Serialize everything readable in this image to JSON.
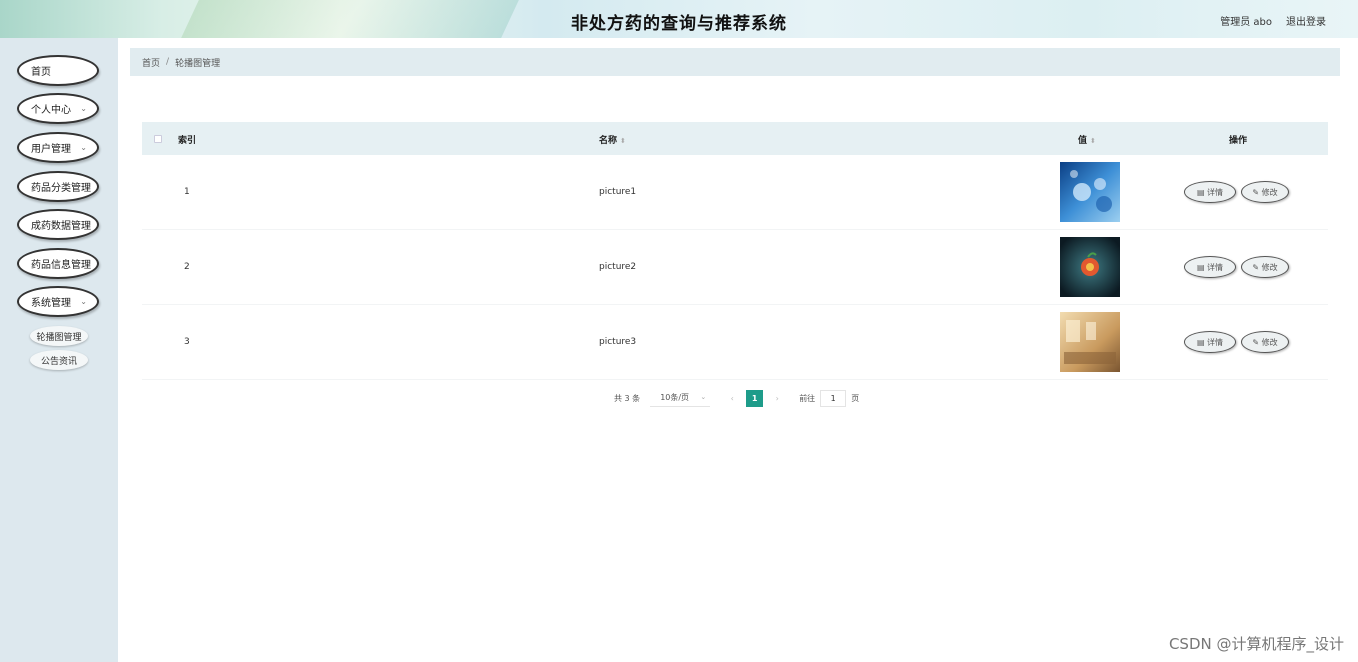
{
  "header": {
    "title": "非处方药的查询与推荐系统",
    "user": "管理员 abo",
    "logout": "退出登录"
  },
  "sidebar": {
    "items": [
      {
        "label": "首页",
        "has_children": false
      },
      {
        "label": "个人中心",
        "has_children": true
      },
      {
        "label": "用户管理",
        "has_children": true
      },
      {
        "label": "药品分类管理",
        "has_children": false
      },
      {
        "label": "成药数据管理",
        "has_children": false
      },
      {
        "label": "药品信息管理",
        "has_children": false
      },
      {
        "label": "系统管理",
        "has_children": true
      }
    ],
    "sub_items": [
      {
        "label": "轮播图管理"
      },
      {
        "label": "公告资讯"
      }
    ]
  },
  "breadcrumb": {
    "home": "首页",
    "separator": "/",
    "current": "轮播图管理"
  },
  "table": {
    "columns": {
      "index": "索引",
      "name": "名称",
      "value": "值",
      "actions": "操作"
    },
    "rows": [
      {
        "index": "1",
        "name": "picture1",
        "image": "blue-tech"
      },
      {
        "index": "2",
        "name": "picture2",
        "image": "dark-fruit"
      },
      {
        "index": "3",
        "name": "picture3",
        "image": "warm-room"
      }
    ],
    "detail_label": "详情",
    "edit_label": "修改"
  },
  "pagination": {
    "total": "共 3 条",
    "page_size": "10条/页",
    "prev": "‹",
    "current_page": "1",
    "next": "›",
    "goto_label": "前往",
    "goto_value": "1",
    "goto_suffix": "页"
  },
  "watermark": "CSDN @计算机程序_设计",
  "colors": {
    "accent": "#1e9c8a",
    "sidebar_bg": "#dde8ee",
    "table_header_bg": "#e6f0f3"
  }
}
